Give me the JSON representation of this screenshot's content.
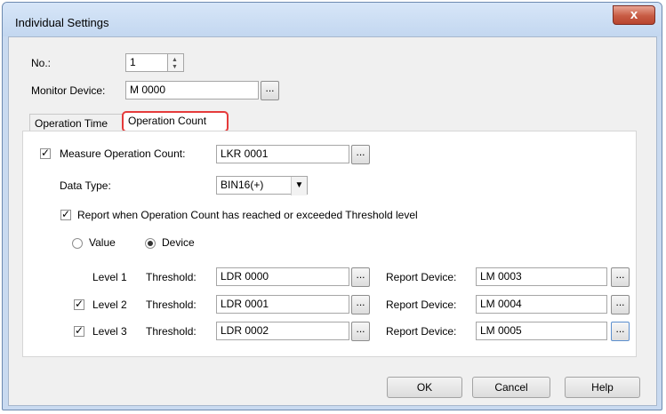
{
  "window": {
    "title": "Individual Settings",
    "close_glyph": "x"
  },
  "no": {
    "label": "No.:",
    "value": "1"
  },
  "monitor_device": {
    "label": "Monitor Device:",
    "value": "M 0000",
    "browse": "..."
  },
  "tabs": [
    {
      "label": "Operation Time",
      "active": false
    },
    {
      "label": "Operation Count",
      "active": true
    }
  ],
  "measure": {
    "label": "Measure Operation Count:",
    "checked": true,
    "value": "LKR 0001",
    "browse": "..."
  },
  "data_type": {
    "label": "Data Type:",
    "value": "BIN16(+)"
  },
  "report": {
    "label": "Report when Operation Count has reached or exceeded Threshold level",
    "checked": true
  },
  "threshold_source": {
    "value_label": "Value",
    "device_label": "Device",
    "selected": "Device"
  },
  "levels": [
    {
      "label": "Level 1",
      "has_checkbox": false,
      "checked": false,
      "threshold_label": "Threshold:",
      "threshold": "LDR 0000",
      "report_label": "Report Device:",
      "report_device": "LM 0003"
    },
    {
      "label": "Level 2",
      "has_checkbox": true,
      "checked": true,
      "threshold_label": "Threshold:",
      "threshold": "LDR 0001",
      "report_label": "Report Device:",
      "report_device": "LM 0004"
    },
    {
      "label": "Level 3",
      "has_checkbox": true,
      "checked": true,
      "threshold_label": "Threshold:",
      "threshold": "LDR 0002",
      "report_label": "Report Device:",
      "report_device": "LM 0005"
    }
  ],
  "buttons": {
    "ok": "OK",
    "cancel": "Cancel",
    "help": "Help"
  },
  "glyphs": {
    "check": "✓",
    "dropdown": "▼",
    "spin_up": "▲",
    "spin_down": "▼"
  }
}
